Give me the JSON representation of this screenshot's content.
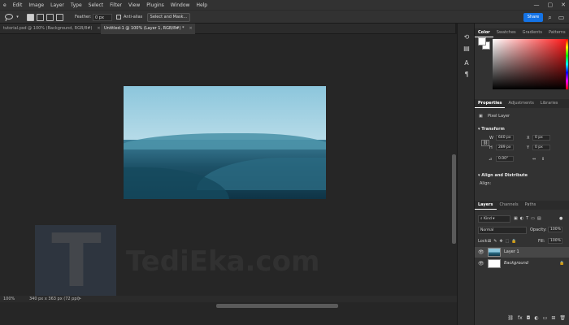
{
  "menu": [
    "e",
    "Edit",
    "Image",
    "Layer",
    "Type",
    "Select",
    "Filter",
    "View",
    "Plugins",
    "Window",
    "Help"
  ],
  "window_controls": {
    "minimize": "—",
    "maximize": "▢",
    "close": "✕"
  },
  "options_bar": {
    "feather_label": "Feather:",
    "feather_value": "0 px",
    "anti_alias_label": "Anti-alias",
    "select_and_mask": "Select and Mask...",
    "share": "Share"
  },
  "tabs": [
    {
      "label": "tutorial.psd @ 100% (Background, RGB/8#)",
      "close": "×"
    },
    {
      "label": "Untitled-1 @ 100% (Layer 1, RGB/8#) *",
      "close": "×"
    }
  ],
  "status": {
    "zoom": "100%",
    "size": "340 px x 363 px (72 ppi)",
    "arrow": ">"
  },
  "watermark": {
    "letter": "T",
    "text": "TediEka.com"
  },
  "color_panel": {
    "tabs": [
      "Color",
      "Swatches",
      "Gradients",
      "Patterns"
    ],
    "fg_color": "#ffffff",
    "bg_color": "#ffffff",
    "hue_color": "#ff1a1a"
  },
  "properties_panel": {
    "tabs": [
      "Properties",
      "Adjustments",
      "Libraries"
    ],
    "type": "Pixel Layer",
    "transform_header": "Transform",
    "w_label": "W",
    "w_value": "640 px",
    "h_label": "H",
    "h_value": "289 px",
    "x_label": "X",
    "x_value": "0 px",
    "y_label": "Y",
    "y_value": "0 px",
    "angle_value": "0.00°",
    "align_header": "Align and Distribute",
    "align_label": "Align:"
  },
  "layers_panel": {
    "tabs": [
      "Layers",
      "Channels",
      "Paths"
    ],
    "filter_kind": "Kind",
    "blend_mode": "Normal",
    "opacity_label": "Opacity:",
    "opacity_value": "100%",
    "lock_label": "Lock:",
    "fill_label": "Fill:",
    "fill_value": "100%",
    "layers": [
      {
        "name": "Layer 1",
        "selected": true
      },
      {
        "name": "Background",
        "selected": false
      }
    ],
    "footer_icons": [
      "link-icon",
      "fx-icon",
      "mask-icon",
      "adjustment-icon",
      "folder-icon",
      "new-layer-icon",
      "trash-icon"
    ]
  }
}
